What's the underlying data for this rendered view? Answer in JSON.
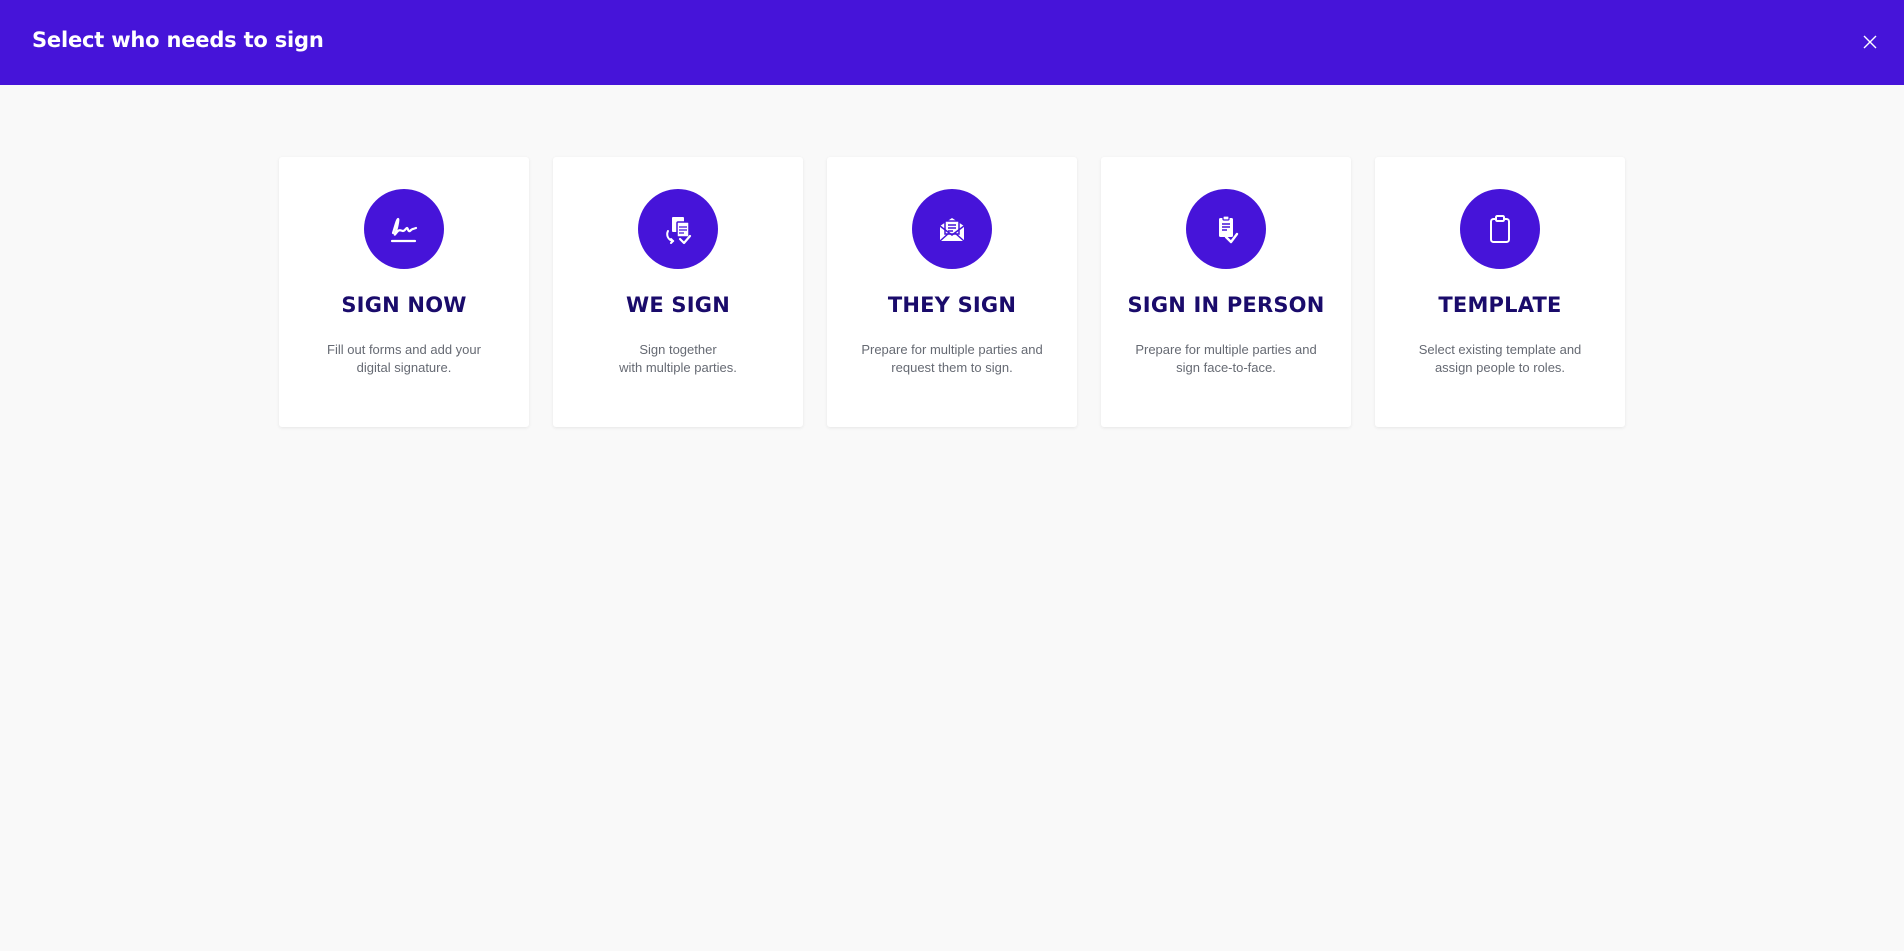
{
  "header": {
    "title": "Select who needs to sign",
    "close_icon": "close-icon"
  },
  "colors": {
    "brand": "#4614d9",
    "title_text": "#1a0b6b",
    "desc_text": "#666a73",
    "background": "#f9f9f9"
  },
  "options": [
    {
      "icon": "signature-icon",
      "title": "SIGN NOW",
      "description": "Fill out forms and add your digital signature."
    },
    {
      "icon": "documents-exchange-icon",
      "title": "WE SIGN",
      "description": "Sign together\nwith multiple parties."
    },
    {
      "icon": "envelope-open-icon",
      "title": "THEY SIGN",
      "description": "Prepare for multiple parties and request them to sign."
    },
    {
      "icon": "document-sign-icon",
      "title": "SIGN IN PERSON",
      "description": "Prepare for multiple parties and sign face-to-face."
    },
    {
      "icon": "clipboard-icon",
      "title": "TEMPLATE",
      "description": "Select existing template and assign people to roles."
    }
  ]
}
